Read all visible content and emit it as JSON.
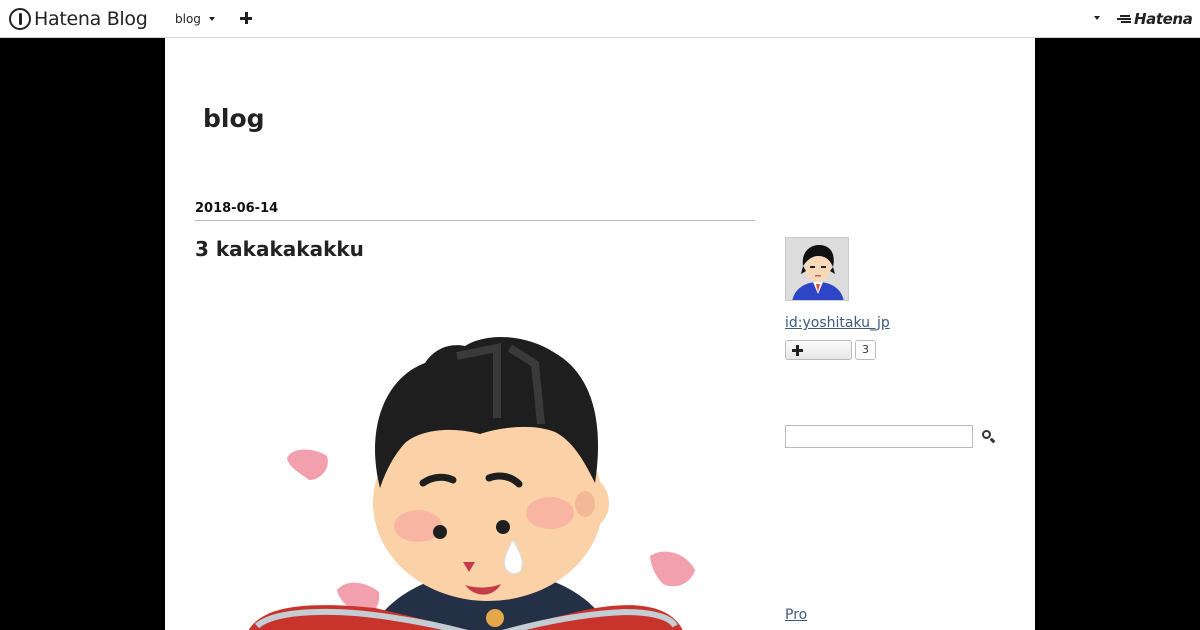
{
  "global_header": {
    "brand": "Hatena Blog",
    "blog_switcher_label": "blog",
    "hatena_label": "Hatena"
  },
  "blog": {
    "title": "blog"
  },
  "entry": {
    "date": "2018-06-14",
    "title": "3 kakakakakku",
    "image_icon": "boy-reading-book-crying-illustration"
  },
  "sidebar": {
    "profile_id": "id:yoshitaku_jp",
    "follow_count": "3",
    "search_value": "",
    "pro_link": "Pro"
  },
  "colors": {
    "link": "#3d5a80",
    "page_background": "#000000",
    "content_background": "#ffffff",
    "hair": "#1e1e1e",
    "skin": "#fbd2a8",
    "petal": "#f2a0ae",
    "book": "#c8332b"
  }
}
